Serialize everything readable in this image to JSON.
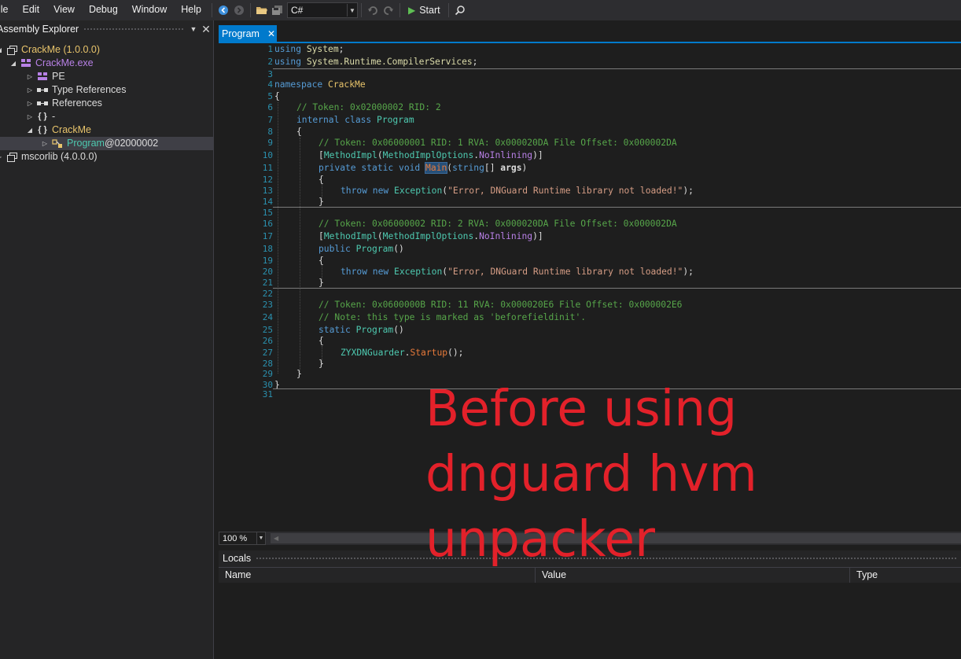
{
  "menu": [
    "ile",
    "Edit",
    "View",
    "Debug",
    "Window",
    "Help"
  ],
  "toolbar": {
    "language": "C#",
    "start_label": "Start",
    "icons": [
      "back-icon",
      "forward-icon",
      "open-folder-icon",
      "save-all-icon",
      "undo-icon",
      "redo-icon",
      "play-icon",
      "search-icon"
    ]
  },
  "explorer": {
    "title": "Assembly Explorer",
    "items": [
      {
        "label": "CrackMe (1.0.0.0)",
        "icon": "assembly-icon"
      },
      {
        "label": "CrackMe.exe",
        "icon": "module-icon"
      },
      {
        "label": "PE",
        "icon": "pe-icon"
      },
      {
        "label": "Type References",
        "icon": "type-references-icon"
      },
      {
        "label": "References",
        "icon": "references-icon"
      },
      {
        "label": "-",
        "icon": "namespace-icon"
      },
      {
        "label": "CrackMe",
        "icon": "namespace-icon"
      },
      {
        "label": "Program",
        "suffix": " @02000002",
        "icon": "class-icon"
      },
      {
        "label": "mscorlib (4.0.0.0)",
        "icon": "assembly-icon"
      }
    ]
  },
  "editor": {
    "tab_label": "Program",
    "line_numbers": [
      "1",
      "2",
      "3",
      "4",
      "5",
      "6",
      "7",
      "8",
      "9",
      "10",
      "11",
      "12",
      "13",
      "14",
      "15",
      "16",
      "17",
      "18",
      "19",
      "20",
      "21",
      "22",
      "23",
      "24",
      "25",
      "26",
      "27",
      "28",
      "29",
      "30",
      "31"
    ],
    "code": {
      "l1_kw": "using",
      "l1_ns": "System",
      "l1_end": ";",
      "l2_kw": "using",
      "l2_ns": "System.Runtime.CompilerServices",
      "l2_end": ";",
      "l4_kw": "namespace",
      "l4_ns": "CrackMe",
      "l5": "{",
      "l6": "// Token: 0x02000002 RID: 2",
      "l7_kw": "internal class",
      "l7_ty": "Program",
      "l8": "{",
      "l9": "// Token: 0x06000001 RID: 1 RVA: 0x000020DA File Offset: 0x000002DA",
      "l10_open": "[",
      "l10_ty": "MethodImpl",
      "l10_p1": "(",
      "l10_ty2": "MethodImplOptions",
      "l10_dot": ".",
      "l10_en": "NoInlining",
      "l10_close": ")]",
      "l11_kw": "private static void",
      "l11_me": "Main",
      "l11_p": "(",
      "l11_kw2": "string",
      "l11_rest": "[] ",
      "l11_args": "args",
      "l11_close": ")",
      "l12": "{",
      "l13_kw": "throw new",
      "l13_ty": "Exception",
      "l13_p": "(",
      "l13_st": "\"Error, DNGuard Runtime library not loaded!\"",
      "l13_end": ");",
      "l14": "}",
      "l16": "// Token: 0x06000002 RID: 2 RVA: 0x000020DA File Offset: 0x000002DA",
      "l17_open": "[",
      "l17_ty": "MethodImpl",
      "l17_p1": "(",
      "l17_ty2": "MethodImplOptions",
      "l17_dot": ".",
      "l17_en": "NoInlining",
      "l17_close": ")]",
      "l18_kw": "public",
      "l18_ty": "Program",
      "l18_rest": "()",
      "l19": "{",
      "l20_kw": "throw new",
      "l20_ty": "Exception",
      "l20_p": "(",
      "l20_st": "\"Error, DNGuard Runtime library not loaded!\"",
      "l20_end": ");",
      "l21": "}",
      "l23": "// Token: 0x0600000B RID: 11 RVA: 0x000020E6 File Offset: 0x000002E6",
      "l24": "// Note: this type is marked as 'beforefieldinit'.",
      "l25_kw": "static",
      "l25_ty": "Program",
      "l25_rest": "()",
      "l26": "{",
      "l27_ty": "ZYXDNGuarder",
      "l27_dot": ".",
      "l27_me": "Startup",
      "l27_end": "();",
      "l28": "}",
      "l29": "}",
      "l30": "}"
    }
  },
  "zoom": "100 %",
  "locals": {
    "title": "Locals",
    "columns": [
      "Name",
      "Value",
      "Type"
    ]
  },
  "overlay_caption": {
    "line1": "Before using",
    "line2": "dnguard hvm",
    "line3": "unpacker"
  },
  "colors": {
    "accent": "#007acc",
    "caption": "#e3212a",
    "comment": "#57a64a",
    "keyword": "#569cd6",
    "type": "#4ec9b0"
  }
}
